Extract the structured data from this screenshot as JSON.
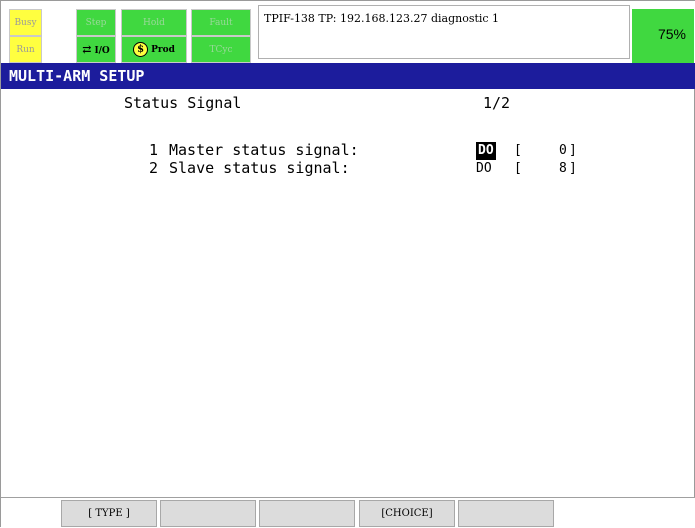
{
  "status_lamps": {
    "busy": "Busy",
    "step": "Step",
    "hold": "Hold",
    "fault": "Fault",
    "run": "Run",
    "io": "I/O",
    "prod": "Prod",
    "tcyc": "TCyc"
  },
  "tp_message": "TPIF-138 TP: 192.168.123.27 diagnostic 1",
  "override": "75%",
  "screen_title": "MULTI-ARM SETUP",
  "section": {
    "title": "Status Signal",
    "page": "1/2"
  },
  "signals": [
    {
      "index": "1",
      "label": "Master status signal:",
      "type": "DO",
      "bracket_open": "[",
      "value": "0",
      "bracket_close": "]"
    },
    {
      "index": "2",
      "label": "Slave status signal:",
      "type": "DO",
      "bracket_open": "[",
      "value": "8",
      "bracket_close": "]"
    }
  ],
  "function_keys": [
    "[ TYPE ]",
    "",
    "",
    "[CHOICE]",
    ""
  ],
  "colors": {
    "title_bar": "#1c1c9c",
    "lamp_yellow": "#ffff40",
    "lamp_green": "#40d840",
    "selection": "#000000"
  }
}
